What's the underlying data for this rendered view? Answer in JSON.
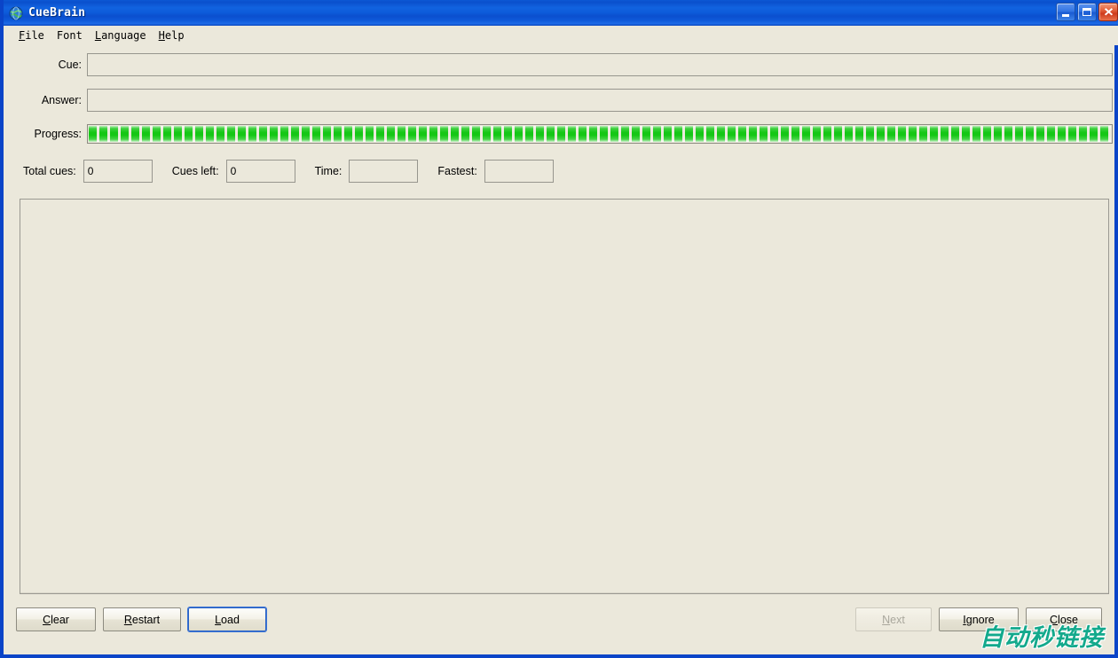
{
  "window": {
    "title": "CueBrain",
    "icon": "globe-icon",
    "frame_color": "#0a44c8",
    "background_color": "#ebe8db",
    "controls": [
      {
        "name": "minimize",
        "glyph": "_"
      },
      {
        "name": "maximize",
        "glyph": "□"
      },
      {
        "name": "close",
        "glyph": "✕"
      }
    ]
  },
  "menubar": {
    "items": [
      {
        "label": "File",
        "accel": "F"
      },
      {
        "label": "Font",
        "accel": ""
      },
      {
        "label": "Language",
        "accel": "L"
      },
      {
        "label": "Help",
        "accel": "H"
      }
    ]
  },
  "form": {
    "cue": {
      "label": "Cue:",
      "value": "",
      "placeholder": ""
    },
    "answer": {
      "label": "Answer:",
      "value": "",
      "placeholder": ""
    },
    "progress": {
      "label": "Progress:",
      "percent": 100,
      "fill_color": "#15c715"
    },
    "total_cues": {
      "label": "Total cues:",
      "value": "0"
    },
    "cues_left": {
      "label": "Cues left:",
      "value": "0"
    },
    "time": {
      "label": "Time:",
      "value": ""
    },
    "fastest": {
      "label": "Fastest:",
      "value": ""
    }
  },
  "log_area": {
    "value": ""
  },
  "buttons": {
    "left": [
      {
        "name": "clear",
        "label": "Clear",
        "accel": "C",
        "state": "enabled"
      },
      {
        "name": "restart",
        "label": "Restart",
        "accel": "R",
        "state": "enabled"
      },
      {
        "name": "load",
        "label": "Load",
        "accel": "L",
        "state": "focused"
      }
    ],
    "right": [
      {
        "name": "next",
        "label": "Next",
        "accel": "N",
        "state": "disabled"
      },
      {
        "name": "ignore",
        "label": "Ignore",
        "accel": "I",
        "state": "enabled"
      },
      {
        "name": "close",
        "label": "Close",
        "accel": "C",
        "state": "enabled"
      }
    ]
  },
  "watermark": {
    "text": "自动秒链接",
    "color": "#13a98c"
  }
}
